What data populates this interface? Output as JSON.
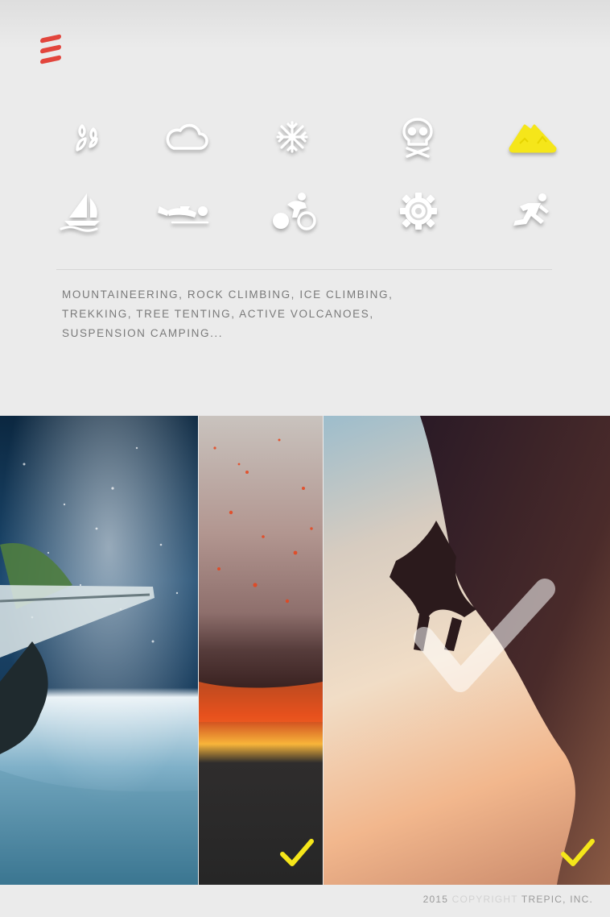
{
  "menu": {
    "icon": "hamburger-menu-icon",
    "color": "#e2453c"
  },
  "categories": [
    {
      "icon": "leaves-icon",
      "selected": false
    },
    {
      "icon": "cloud-icon",
      "selected": false
    },
    {
      "icon": "snowflake-icon",
      "selected": false
    },
    {
      "icon": "skull-crossbones-icon",
      "selected": false
    },
    {
      "icon": "mountain-icon",
      "selected": true
    },
    {
      "icon": "sailboat-icon",
      "selected": false
    },
    {
      "icon": "diver-icon",
      "selected": false
    },
    {
      "icon": "cyclist-icon",
      "selected": false
    },
    {
      "icon": "gear-icon",
      "selected": false
    },
    {
      "icon": "runner-icon",
      "selected": false
    }
  ],
  "accent_color": "#f5e61a",
  "description": {
    "line1": "MOUNTAINEERING, ROCK CLIMBING, ICE CLIMBING,",
    "line2": "TREKKING, TREE TENTING, ACTIVE VOLCANOES,",
    "line3": "SUSPENSION CAMPING..."
  },
  "gallery": [
    {
      "name": "windsurfing-photo",
      "checked": false
    },
    {
      "name": "volcano-photo",
      "checked": true
    },
    {
      "name": "rock-climbing-photo",
      "checked": true
    }
  ],
  "footer": {
    "year": "2015",
    "copyright": "COPYRIGHT",
    "company": "TREPIC, INC."
  }
}
